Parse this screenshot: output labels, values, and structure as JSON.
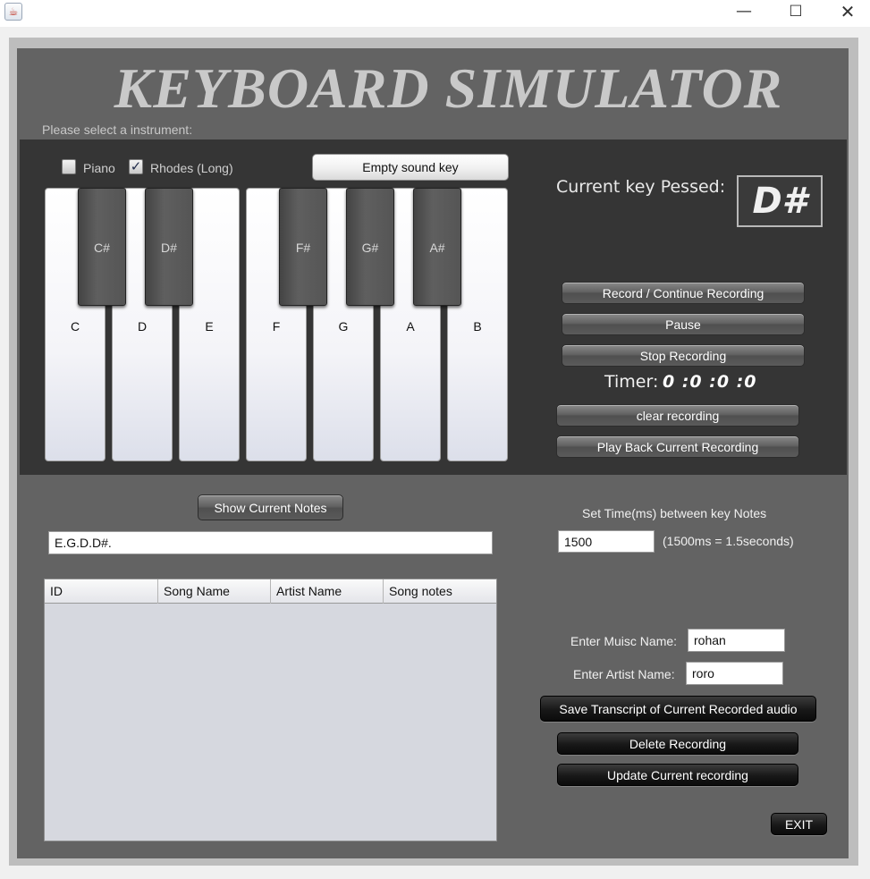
{
  "window": {
    "app_icon": "java-cup-icon",
    "minimize": "—",
    "maximize": "☐",
    "close": "✕"
  },
  "title": "KEYBOARD SIMULATOR",
  "instrument_prompt": "Please select a instrument:",
  "instruments": [
    {
      "label": "Piano",
      "checked": false
    },
    {
      "label": "Rhodes (Long)",
      "checked": true
    }
  ],
  "empty_sound_key_label": "Empty sound key",
  "white_keys": [
    "C",
    "D",
    "E",
    "F",
    "G",
    "A",
    "B"
  ],
  "black_keys": [
    "C#",
    "D#",
    "F#",
    "G#",
    "A#"
  ],
  "current_key": {
    "label": "Current key Pessed:",
    "value": "D#"
  },
  "recording_controls": {
    "record": "Record / Continue Recording",
    "pause": "Pause",
    "stop": "Stop Recording",
    "clear": "clear recording",
    "play_back": "Play Back Current Recording"
  },
  "timer": {
    "label": "Timer:",
    "value": "0 :0 :0 :0"
  },
  "show_notes_label": "Show Current Notes",
  "notes_value": "E.G.D.D#.",
  "set_time": {
    "label": "Set Time(ms) between key Notes",
    "value": "1500",
    "hint": "(1500ms = 1.5seconds)"
  },
  "table": {
    "columns": [
      "ID",
      "Song Name",
      "Artist Name",
      "Song notes"
    ],
    "rows": []
  },
  "music_name": {
    "label": "Enter Muisc Name:",
    "value": "rohan"
  },
  "artist_name": {
    "label": "Enter Artist Name:",
    "value": "roro"
  },
  "actions": {
    "save": "Save Transcript of Current Recorded audio",
    "delete": "Delete Recording",
    "update": "Update Current recording",
    "exit": "EXIT"
  },
  "colors": {
    "panel": "#636363",
    "dark_panel": "#353535",
    "frame": "#bdbdbd"
  }
}
